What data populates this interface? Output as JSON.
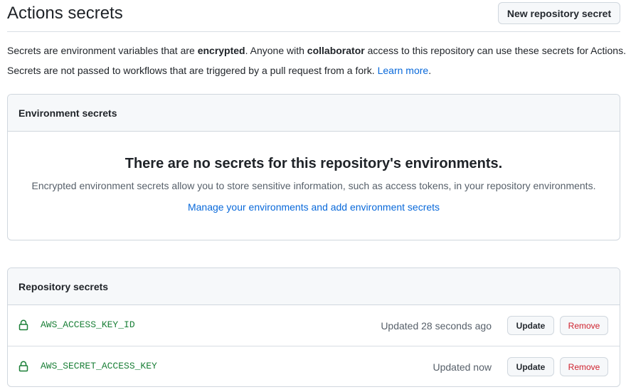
{
  "header": {
    "title": "Actions secrets",
    "new_button": "New repository secret"
  },
  "description": {
    "line1_a": "Secrets are environment variables that are ",
    "line1_b": "encrypted",
    "line1_c": ". Anyone with ",
    "line1_d": "collaborator",
    "line1_e": " access to this repository can use these secrets for Actions.",
    "line2_a": "Secrets are not passed to workflows that are triggered by a pull request from a fork. ",
    "line2_link": "Learn more",
    "line2_end": "."
  },
  "environment": {
    "heading": "Environment secrets",
    "empty_title": "There are no secrets for this repository's environments.",
    "empty_desc": "Encrypted environment secrets allow you to store sensitive information, such as access tokens, in your repository environments.",
    "manage_link": "Manage your environments and add environment secrets"
  },
  "repository": {
    "heading": "Repository secrets",
    "secrets": [
      {
        "name": "AWS_ACCESS_KEY_ID",
        "updated": "Updated 28 seconds ago",
        "update_label": "Update",
        "remove_label": "Remove"
      },
      {
        "name": "AWS_SECRET_ACCESS_KEY",
        "updated": "Updated now",
        "update_label": "Update",
        "remove_label": "Remove"
      }
    ]
  },
  "colors": {
    "link": "#0969da",
    "secret_name": "#1a7f37",
    "danger": "#cf222e"
  },
  "icons": {
    "secret_icon": "lock-icon"
  }
}
